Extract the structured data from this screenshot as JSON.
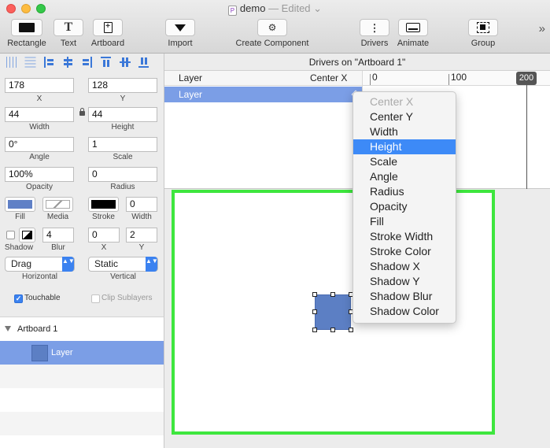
{
  "window": {
    "title": "demo",
    "status": "— Edited",
    "status_caret": "⌄",
    "doc_badge": "P"
  },
  "toolbar": {
    "rectangle": "Rectangle",
    "text": "Text",
    "text_glyph": "T",
    "artboard": "Artboard",
    "artboard_glyph": "+",
    "import": "Import",
    "create_component": "Create Component",
    "gear_glyph": "⚙",
    "drivers": "Drivers",
    "drivers_glyph": "⋮",
    "animate": "Animate",
    "group": "Group",
    "overflow": "»"
  },
  "inspector": {
    "x": "178",
    "x_label": "X",
    "y": "128",
    "y_label": "Y",
    "width": "44",
    "width_label": "Width",
    "height": "44",
    "height_label": "Height",
    "angle": "0°",
    "angle_label": "Angle",
    "scale": "1",
    "scale_label": "Scale",
    "opacity": "100%",
    "opacity_label": "Opacity",
    "radius": "0",
    "radius_label": "Radius",
    "fill_label": "Fill",
    "fill_color": "#5f80c6",
    "media_label": "Media",
    "stroke_label": "Stroke",
    "stroke_color": "#000000",
    "stroke_width": "0",
    "stroke_width_label": "Width",
    "shadow_label": "Shadow",
    "blur": "4",
    "blur_label": "Blur",
    "shadow_x": "0",
    "shadow_x_label": "X",
    "shadow_y": "2",
    "shadow_y_label": "Y",
    "horizontal_value": "Drag",
    "horizontal_label": "Horizontal",
    "vertical_value": "Static",
    "vertical_label": "Vertical",
    "touchable_label": "Touchable",
    "touchable_checked": true,
    "clip_label": "Clip Sublayers",
    "clip_checked": false,
    "check_glyph": "✓",
    "select_arrows": "▲▼"
  },
  "layers": {
    "artboard_name": "Artboard 1",
    "layer_name": "Layer"
  },
  "drivers_panel": {
    "header": "Drivers on \"Artboard 1\"",
    "col_layer": "Layer",
    "col_property": "Center X",
    "row_layer": "Layer",
    "ruler": [
      "0",
      "100"
    ],
    "playhead": "200"
  },
  "menu": {
    "items": [
      "Center X",
      "Center Y",
      "Width",
      "Height",
      "Scale",
      "Angle",
      "Radius",
      "Opacity",
      "Fill",
      "Stroke Width",
      "Stroke Color",
      "Shadow X",
      "Shadow Y",
      "Shadow Blur",
      "Shadow Color"
    ],
    "disabled_item": "Center X",
    "highlighted_item": "Height"
  },
  "colors": {
    "artboard_border": "#3ee63e",
    "selection": "#7b9ee6",
    "menu_highlight": "#3d8af7",
    "shape_fill": "#5c7fc4"
  }
}
